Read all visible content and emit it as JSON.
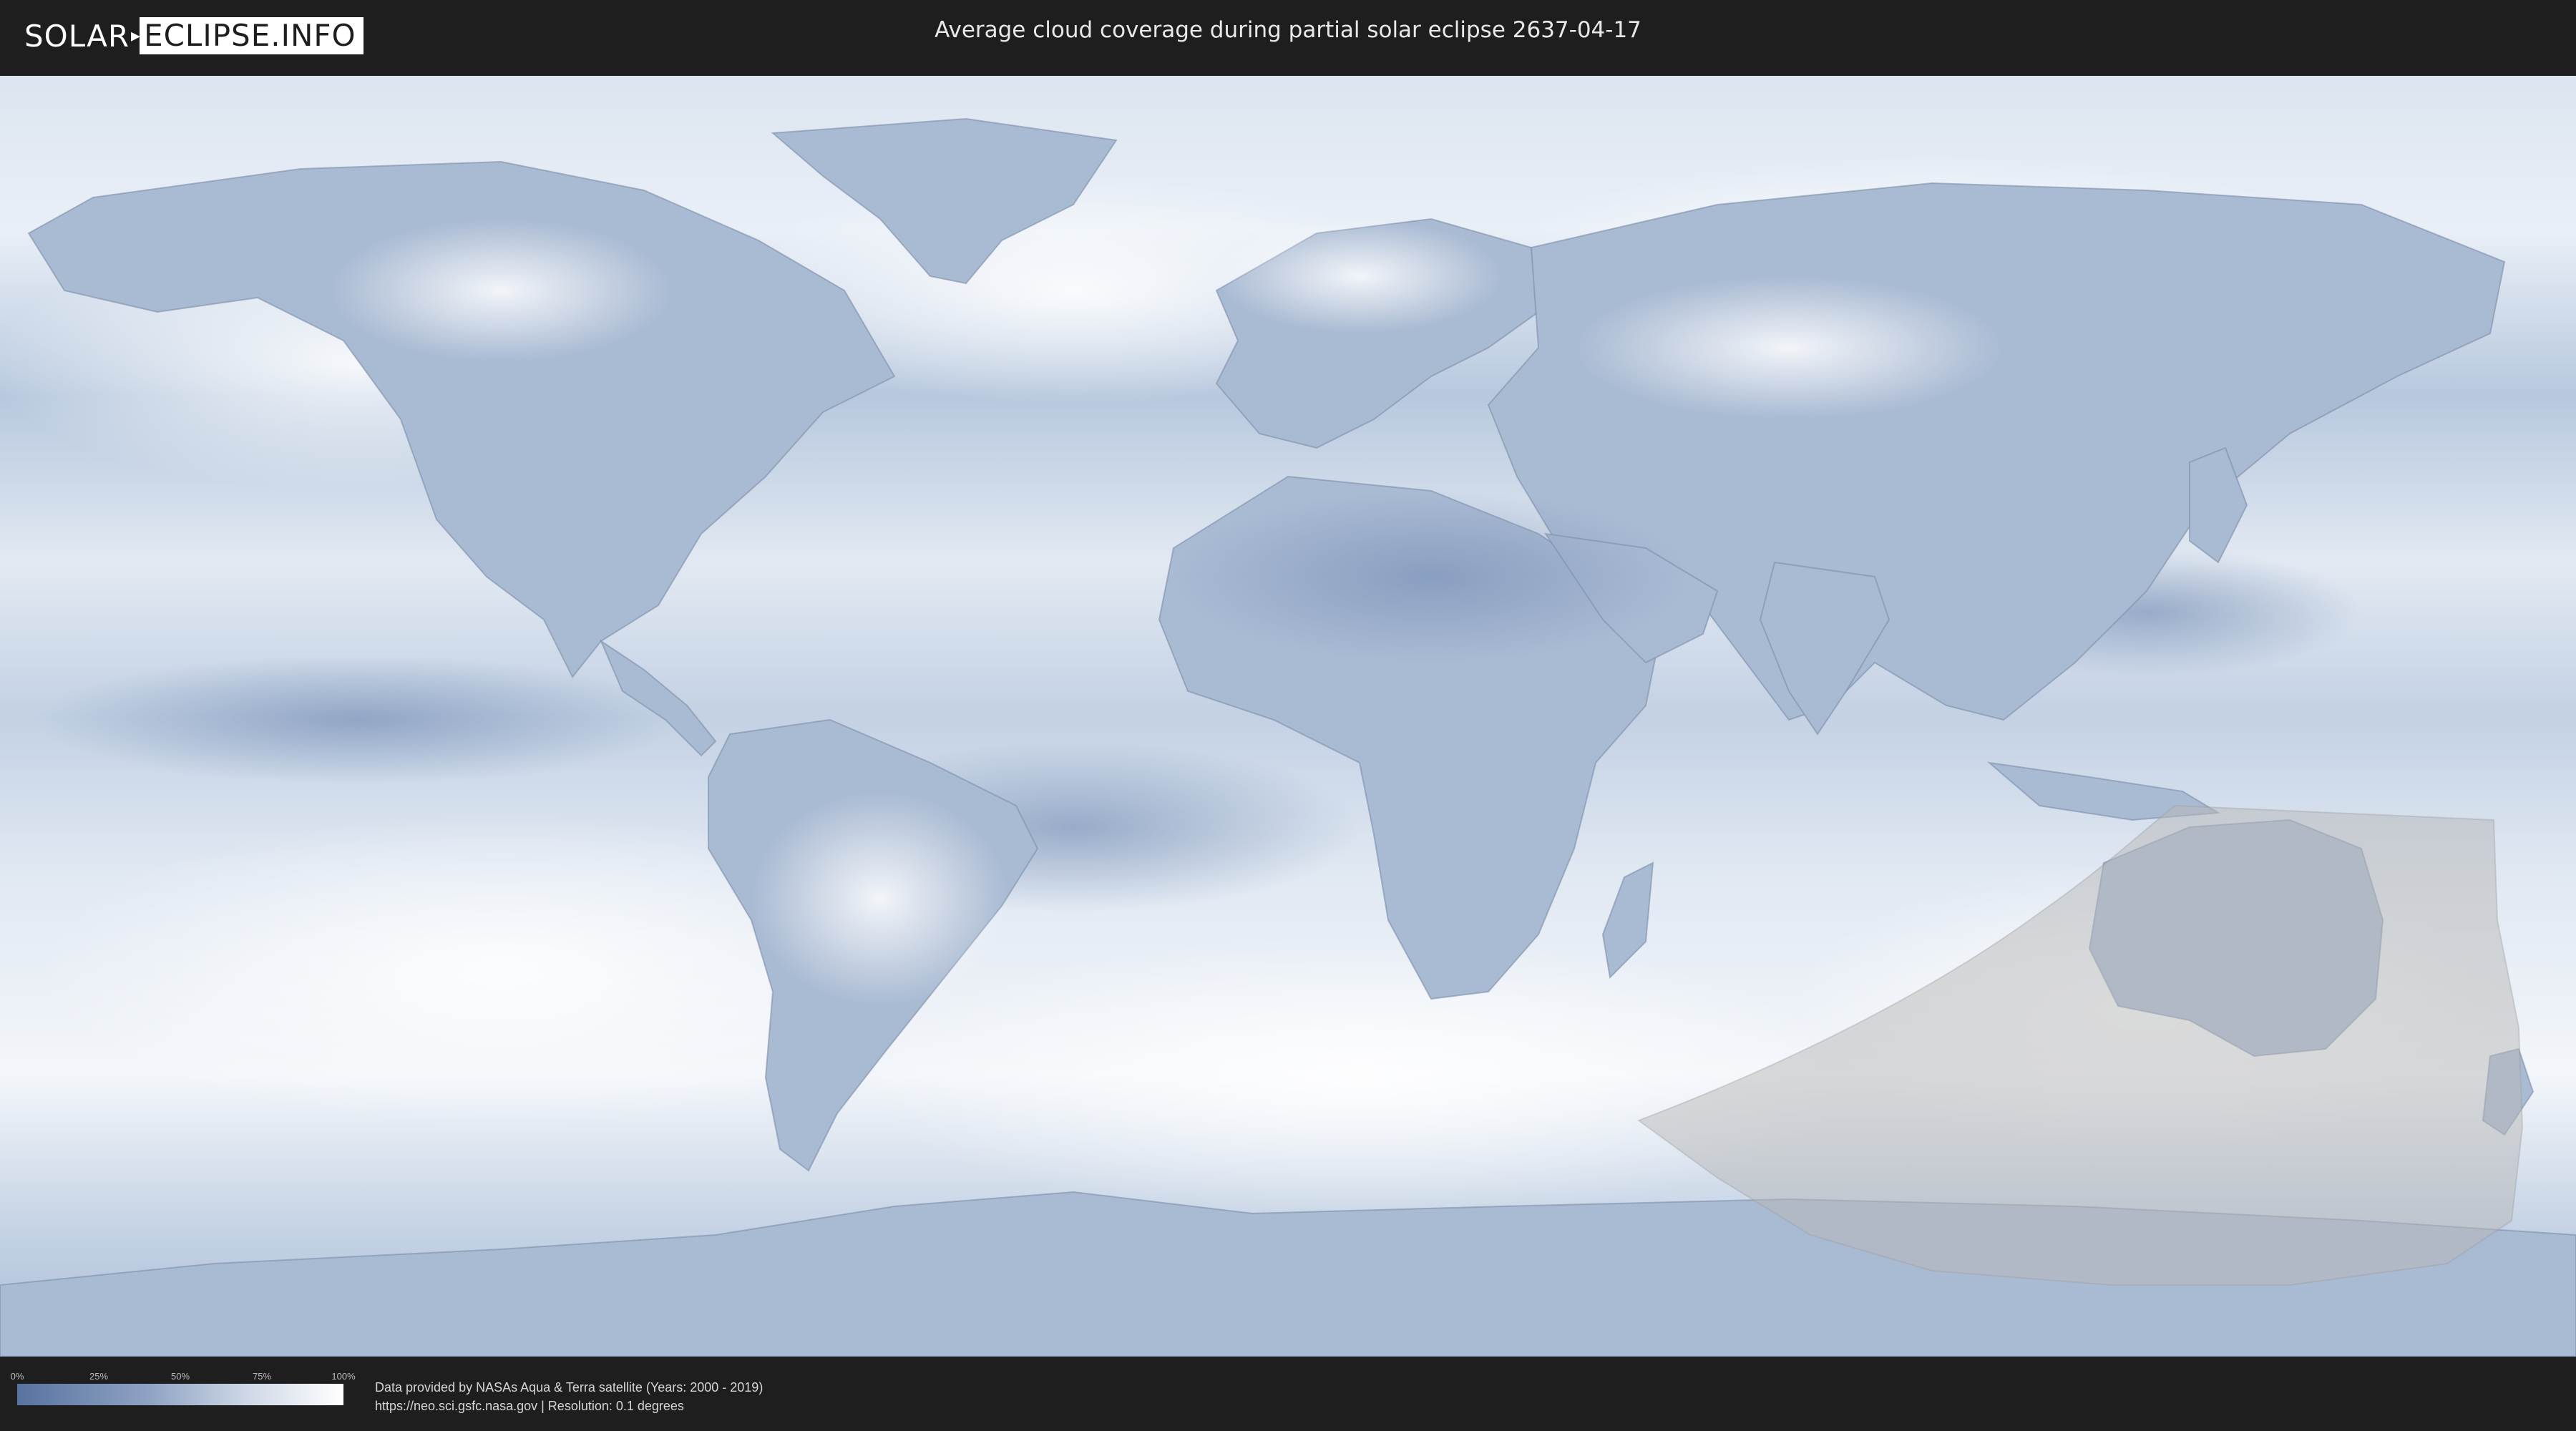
{
  "header": {
    "logo_part1": "SOLAR",
    "logo_part2": "ECLIPSE.INFO",
    "title": "Average cloud coverage during partial solar eclipse 2637-04-17"
  },
  "map": {
    "base_color_clear": "#5873a0",
    "base_color_cloudy": "#ffffff",
    "eclipse_zone_color": "#b8b8b8"
  },
  "legend": {
    "ticks": [
      "0%",
      "25%",
      "50%",
      "75%",
      "100%"
    ],
    "tick_values": [
      0,
      25,
      50,
      75,
      100
    ]
  },
  "credits": {
    "line1": "Data provided by NASAs Aqua & Terra satellite (Years: 2000 - 2019)",
    "line2": "https://neo.sci.gsfc.nasa.gov | Resolution: 0.1 degrees"
  }
}
